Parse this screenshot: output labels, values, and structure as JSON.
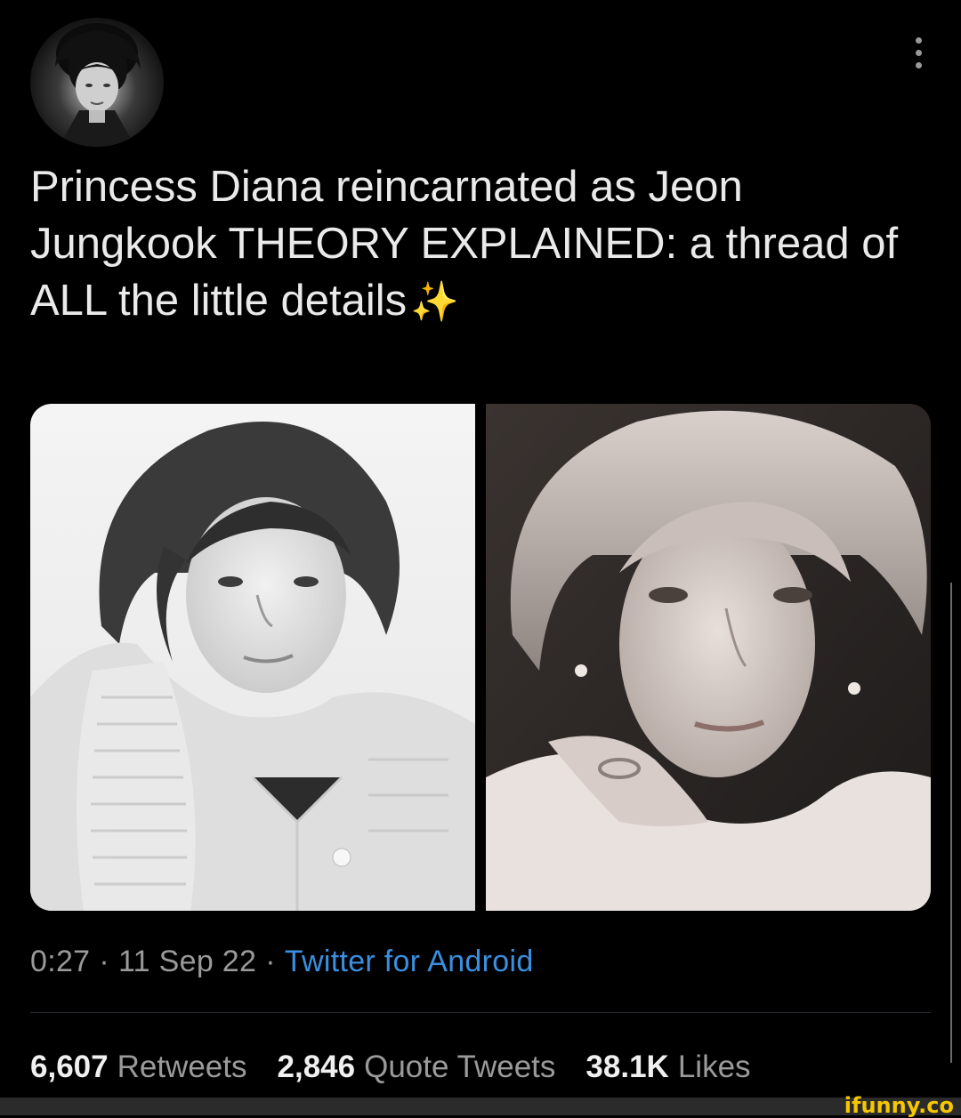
{
  "tweet": {
    "author": {
      "display_name": "",
      "handle": ""
    },
    "text": "Princess Diana reincarnated as Jeon Jungkook THEORY EXPLAINED: a thread of ALL the little details",
    "emoji": "✨",
    "images": [
      {
        "icon": "portrait-photo-1"
      },
      {
        "icon": "portrait-photo-2"
      }
    ],
    "time": "0:27",
    "date": "11 Sep 22",
    "separator": "·",
    "source": "Twitter for Android",
    "stats": {
      "retweets_count": "6,607",
      "retweets_label": "Retweets",
      "quotes_count": "2,846",
      "quotes_label": "Quote Tweets",
      "likes_count": "38.1K",
      "likes_label": "Likes"
    }
  },
  "watermark": "ifunny.co",
  "colors": {
    "background": "#000000",
    "text": "#eaeaea",
    "muted": "#9a9a9a",
    "link": "#3b8fe0",
    "watermark": "#f6c700"
  }
}
